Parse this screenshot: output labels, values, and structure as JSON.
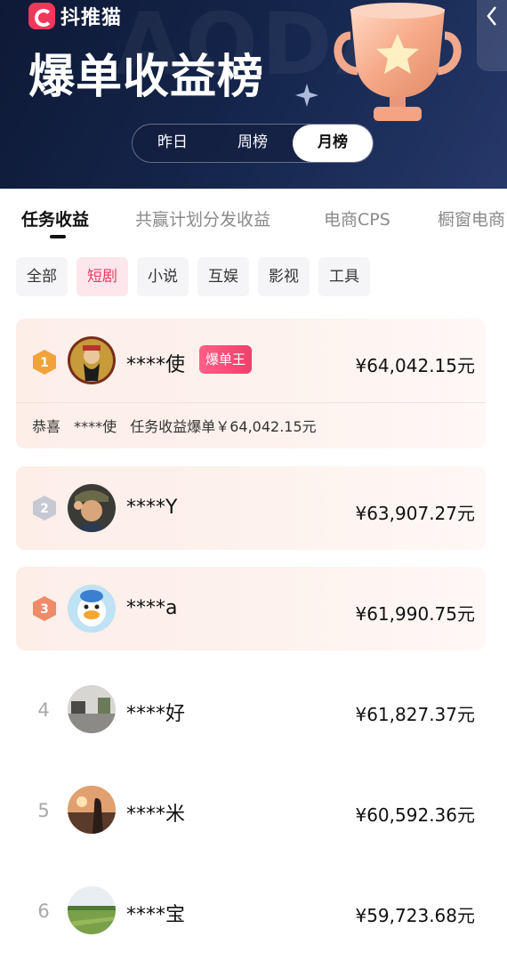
{
  "header": {
    "logo_text": "抖推猫",
    "title": "爆单收益榜",
    "watermark": "AODA",
    "period_tabs": [
      "昨日",
      "周榜",
      "月榜"
    ],
    "active_period": "月榜"
  },
  "category_tabs": [
    "任务收益",
    "共赢计划分发收益",
    "电商CPS",
    "橱窗电商"
  ],
  "active_category": "任务收益",
  "filter_chips": [
    "全部",
    "短剧",
    "小说",
    "互娱",
    "影视",
    "工具"
  ],
  "active_chip": "短剧",
  "ranking": [
    {
      "rank": "1",
      "name": "****使",
      "amount": "¥64,042.15元",
      "tag": "爆单王"
    },
    {
      "rank": "2",
      "name": "****Y",
      "amount": "¥63,907.27元"
    },
    {
      "rank": "3",
      "name": "****a",
      "amount": "¥61,990.75元"
    },
    {
      "rank": "4",
      "name": "****好",
      "amount": "¥61,827.37元"
    },
    {
      "rank": "5",
      "name": "****米",
      "amount": "¥60,592.36元"
    },
    {
      "rank": "6",
      "name": "****宝",
      "amount": "¥59,723.68元"
    }
  ],
  "congrats": {
    "prefix": "恭喜",
    "name": "****使",
    "text": "任务收益爆单￥64,042.15元"
  },
  "colors": {
    "accent": "#f03f6b",
    "header_bg": "#142449",
    "gold": "#f2a23a",
    "silver": "#c6c8d2",
    "bronze": "#ef8a6a"
  }
}
